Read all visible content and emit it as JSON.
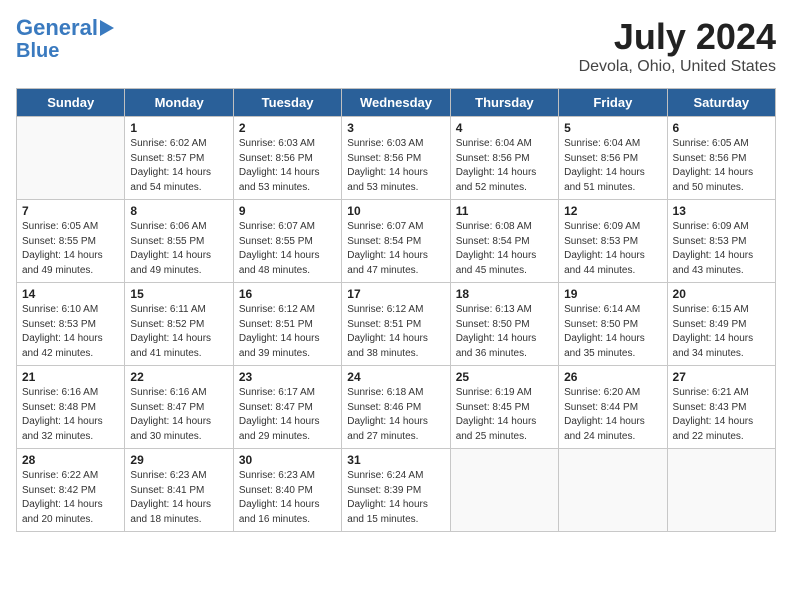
{
  "logo": {
    "line1": "General",
    "line2": "Blue"
  },
  "title": "July 2024",
  "subtitle": "Devola, Ohio, United States",
  "days_of_week": [
    "Sunday",
    "Monday",
    "Tuesday",
    "Wednesday",
    "Thursday",
    "Friday",
    "Saturday"
  ],
  "weeks": [
    [
      {
        "day": "",
        "empty": true
      },
      {
        "day": "1",
        "sunrise": "6:02 AM",
        "sunset": "8:57 PM",
        "daylight": "14 hours and 54 minutes."
      },
      {
        "day": "2",
        "sunrise": "6:03 AM",
        "sunset": "8:56 PM",
        "daylight": "14 hours and 53 minutes."
      },
      {
        "day": "3",
        "sunrise": "6:03 AM",
        "sunset": "8:56 PM",
        "daylight": "14 hours and 53 minutes."
      },
      {
        "day": "4",
        "sunrise": "6:04 AM",
        "sunset": "8:56 PM",
        "daylight": "14 hours and 52 minutes."
      },
      {
        "day": "5",
        "sunrise": "6:04 AM",
        "sunset": "8:56 PM",
        "daylight": "14 hours and 51 minutes."
      },
      {
        "day": "6",
        "sunrise": "6:05 AM",
        "sunset": "8:56 PM",
        "daylight": "14 hours and 50 minutes."
      }
    ],
    [
      {
        "day": "7",
        "sunrise": "6:05 AM",
        "sunset": "8:55 PM",
        "daylight": "14 hours and 49 minutes."
      },
      {
        "day": "8",
        "sunrise": "6:06 AM",
        "sunset": "8:55 PM",
        "daylight": "14 hours and 49 minutes."
      },
      {
        "day": "9",
        "sunrise": "6:07 AM",
        "sunset": "8:55 PM",
        "daylight": "14 hours and 48 minutes."
      },
      {
        "day": "10",
        "sunrise": "6:07 AM",
        "sunset": "8:54 PM",
        "daylight": "14 hours and 47 minutes."
      },
      {
        "day": "11",
        "sunrise": "6:08 AM",
        "sunset": "8:54 PM",
        "daylight": "14 hours and 45 minutes."
      },
      {
        "day": "12",
        "sunrise": "6:09 AM",
        "sunset": "8:53 PM",
        "daylight": "14 hours and 44 minutes."
      },
      {
        "day": "13",
        "sunrise": "6:09 AM",
        "sunset": "8:53 PM",
        "daylight": "14 hours and 43 minutes."
      }
    ],
    [
      {
        "day": "14",
        "sunrise": "6:10 AM",
        "sunset": "8:53 PM",
        "daylight": "14 hours and 42 minutes."
      },
      {
        "day": "15",
        "sunrise": "6:11 AM",
        "sunset": "8:52 PM",
        "daylight": "14 hours and 41 minutes."
      },
      {
        "day": "16",
        "sunrise": "6:12 AM",
        "sunset": "8:51 PM",
        "daylight": "14 hours and 39 minutes."
      },
      {
        "day": "17",
        "sunrise": "6:12 AM",
        "sunset": "8:51 PM",
        "daylight": "14 hours and 38 minutes."
      },
      {
        "day": "18",
        "sunrise": "6:13 AM",
        "sunset": "8:50 PM",
        "daylight": "14 hours and 36 minutes."
      },
      {
        "day": "19",
        "sunrise": "6:14 AM",
        "sunset": "8:50 PM",
        "daylight": "14 hours and 35 minutes."
      },
      {
        "day": "20",
        "sunrise": "6:15 AM",
        "sunset": "8:49 PM",
        "daylight": "14 hours and 34 minutes."
      }
    ],
    [
      {
        "day": "21",
        "sunrise": "6:16 AM",
        "sunset": "8:48 PM",
        "daylight": "14 hours and 32 minutes."
      },
      {
        "day": "22",
        "sunrise": "6:16 AM",
        "sunset": "8:47 PM",
        "daylight": "14 hours and 30 minutes."
      },
      {
        "day": "23",
        "sunrise": "6:17 AM",
        "sunset": "8:47 PM",
        "daylight": "14 hours and 29 minutes."
      },
      {
        "day": "24",
        "sunrise": "6:18 AM",
        "sunset": "8:46 PM",
        "daylight": "14 hours and 27 minutes."
      },
      {
        "day": "25",
        "sunrise": "6:19 AM",
        "sunset": "8:45 PM",
        "daylight": "14 hours and 25 minutes."
      },
      {
        "day": "26",
        "sunrise": "6:20 AM",
        "sunset": "8:44 PM",
        "daylight": "14 hours and 24 minutes."
      },
      {
        "day": "27",
        "sunrise": "6:21 AM",
        "sunset": "8:43 PM",
        "daylight": "14 hours and 22 minutes."
      }
    ],
    [
      {
        "day": "28",
        "sunrise": "6:22 AM",
        "sunset": "8:42 PM",
        "daylight": "14 hours and 20 minutes."
      },
      {
        "day": "29",
        "sunrise": "6:23 AM",
        "sunset": "8:41 PM",
        "daylight": "14 hours and 18 minutes."
      },
      {
        "day": "30",
        "sunrise": "6:23 AM",
        "sunset": "8:40 PM",
        "daylight": "14 hours and 16 minutes."
      },
      {
        "day": "31",
        "sunrise": "6:24 AM",
        "sunset": "8:39 PM",
        "daylight": "14 hours and 15 minutes."
      },
      {
        "day": "",
        "empty": true
      },
      {
        "day": "",
        "empty": true
      },
      {
        "day": "",
        "empty": true
      }
    ]
  ]
}
